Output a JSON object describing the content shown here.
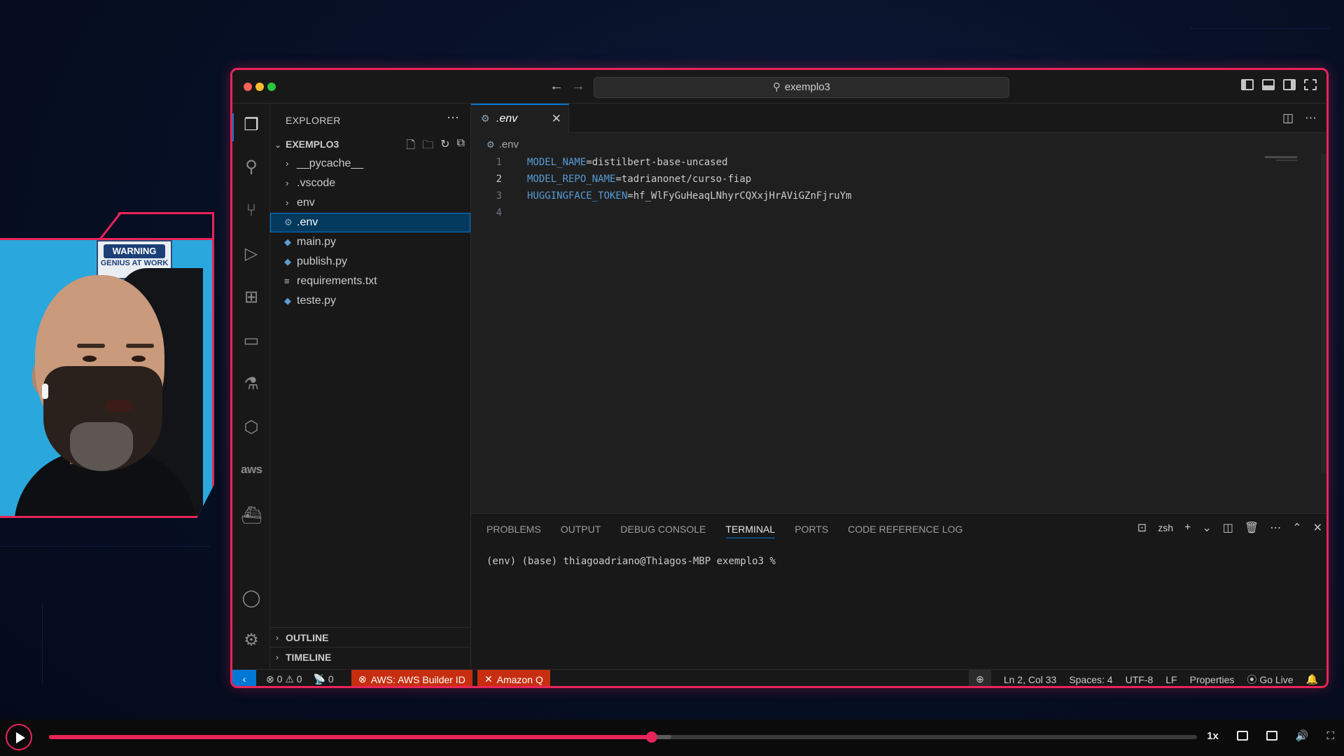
{
  "titlebar": {
    "search_label": "exemplo3"
  },
  "explorer": {
    "header": "EXPLORER",
    "folder": "EXEMPLO3",
    "items": [
      {
        "label": "__pycache__",
        "kind": "folder"
      },
      {
        "label": ".vscode",
        "kind": "folder"
      },
      {
        "label": "env",
        "kind": "folder"
      },
      {
        "label": ".env",
        "kind": "gear-file",
        "selected": true
      },
      {
        "label": "main.py",
        "kind": "python-file"
      },
      {
        "label": "publish.py",
        "kind": "python-file"
      },
      {
        "label": "requirements.txt",
        "kind": "text-file"
      },
      {
        "label": "teste.py",
        "kind": "python-file"
      }
    ],
    "outline_label": "OUTLINE",
    "timeline_label": "TIMELINE"
  },
  "editor": {
    "tab_label": ".env",
    "breadcrumb": ".env",
    "current_line": 2,
    "lines": [
      {
        "num": "1",
        "key": "MODEL_NAME",
        "value": "=distilbert-base-uncased"
      },
      {
        "num": "2",
        "key": "MODEL_REPO_NAME",
        "value": "=tadrianonet/curso-fiap"
      },
      {
        "num": "3",
        "key": "HUGGINGFACE_TOKEN",
        "value": "=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"
      },
      {
        "num": "4",
        "key": "",
        "value": ""
      }
    ]
  },
  "panel": {
    "tabs": [
      "PROBLEMS",
      "OUTPUT",
      "DEBUG CONSOLE",
      "TERMINAL",
      "PORTS",
      "CODE REFERENCE LOG"
    ],
    "active_tab": "TERMINAL",
    "shell": "zsh",
    "terminal_line": "(env) (base) thiagoadriano@Thiagos-MBP exemplo3 %"
  },
  "statusbar": {
    "errors": "0",
    "warnings": "0",
    "ports": "0",
    "aws": "AWS: AWS Builder ID",
    "amazon_q": "Amazon Q",
    "position": "Ln 2, Col 33",
    "spaces": "Spaces: 4",
    "encoding": "UTF-8",
    "eol": "LF",
    "language": "Properties",
    "golive": "Go Live"
  },
  "webcam": {
    "poster_line1": "WARNING",
    "poster_line2": "GENIUS AT WORK"
  },
  "player": {
    "progress": 0.525,
    "speed": "1x"
  },
  "colors": {
    "accent": "#e8245a",
    "vscode_blue": "#0078d4",
    "error_red": "#c72e0f"
  }
}
